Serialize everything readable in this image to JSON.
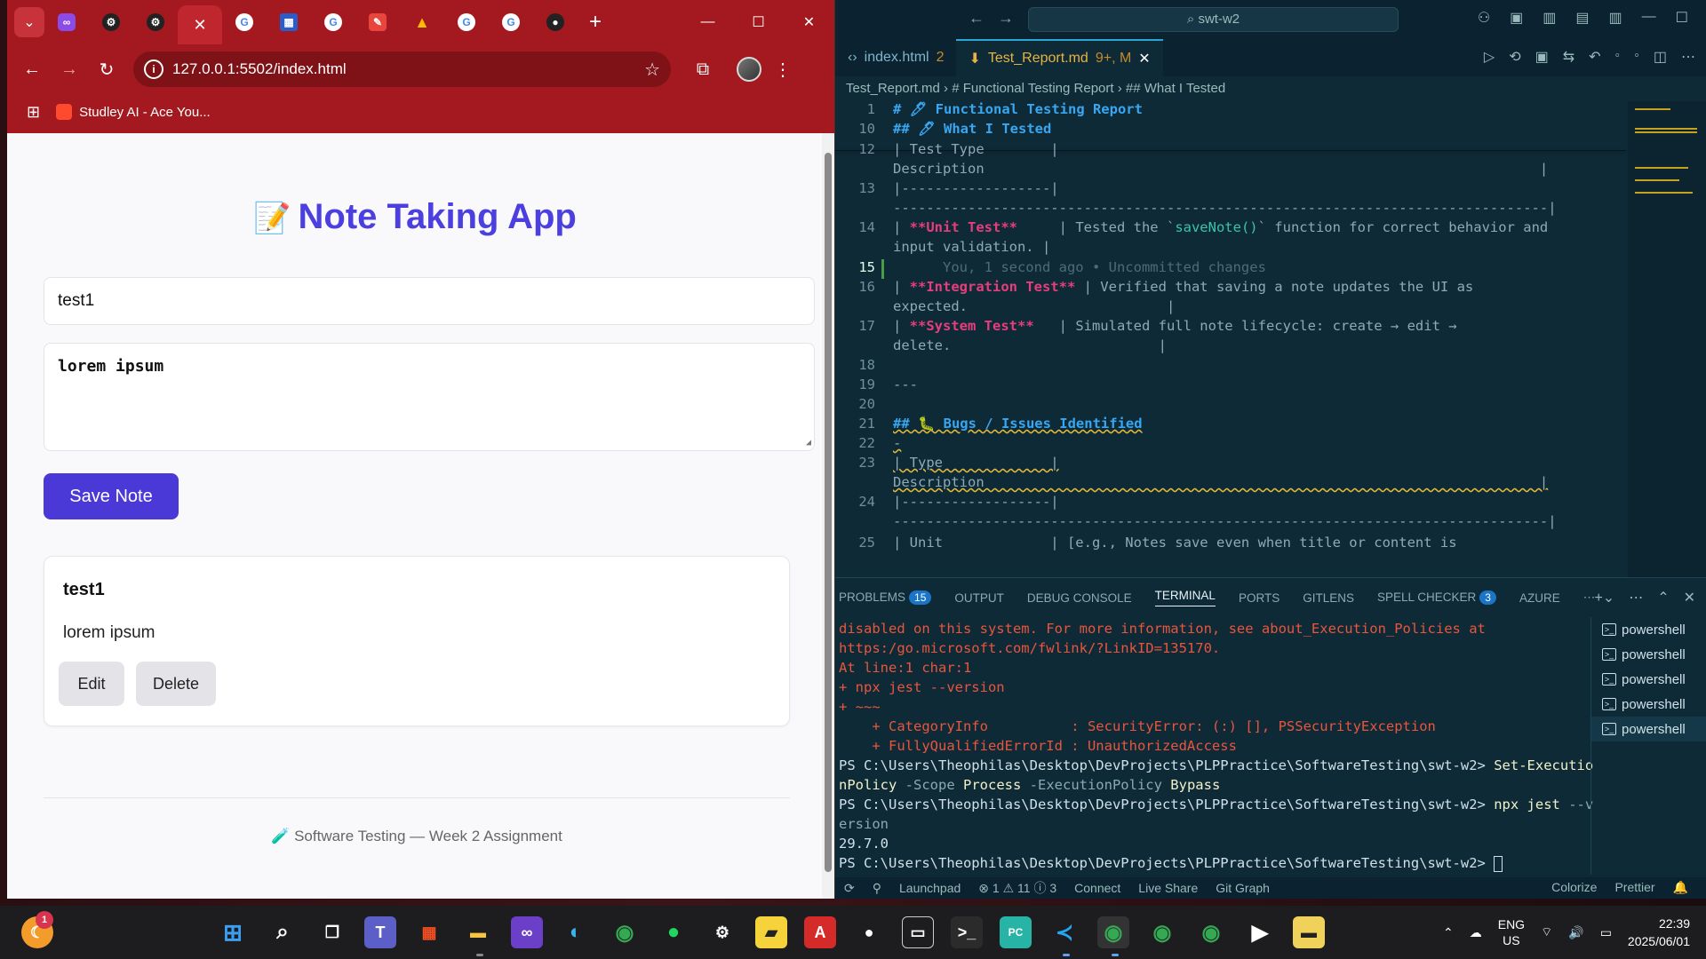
{
  "browser": {
    "tab_close_glyph": "✕",
    "address": "127.0.0.1:5502/index.html",
    "bookmark": "Studley AI - Ace You...",
    "window_controls": [
      "—",
      "☐",
      "✕"
    ]
  },
  "app": {
    "title": "Note Taking App",
    "title_emoji": "📝",
    "title_input_value": "test1",
    "content_input_value": "lorem ipsum",
    "save_label": "Save Note",
    "notes": [
      {
        "title": "test1",
        "body": "lorem ipsum",
        "edit_label": "Edit",
        "delete_label": "Delete"
      }
    ],
    "footer_emoji": "🧪",
    "footer": "Software Testing — Week 2 Assignment"
  },
  "vscode": {
    "search": "swt-w2",
    "tabs": [
      {
        "label": "index.html",
        "count": "2"
      },
      {
        "label": "Test_Report.md",
        "count": "9+, M"
      }
    ],
    "breadcrumb": "Test_Report.md  ›  #  Functional Testing Report  ›  ##  What I Tested",
    "panel_tabs": [
      "PROBLEMS",
      "OUTPUT",
      "DEBUG CONSOLE",
      "TERMINAL",
      "PORTS",
      "GITLENS",
      "SPELL CHECKER",
      "AZURE"
    ],
    "problems_count": "15",
    "spell_count": "3",
    "terminals": [
      "powershell",
      "powershell",
      "powershell",
      "powershell",
      "powershell"
    ],
    "status_left": [
      "Launchpad",
      "⊗ 1 ⚠ 11 ⓘ 3",
      "Connect",
      "Live Share",
      "Git Graph"
    ],
    "status_right": [
      "Colorize",
      "Prettier"
    ]
  },
  "taskbar": {
    "lang": "ENG",
    "region": "US",
    "time": "22:39",
    "date": "2025/06/01",
    "notification_count": "1"
  }
}
